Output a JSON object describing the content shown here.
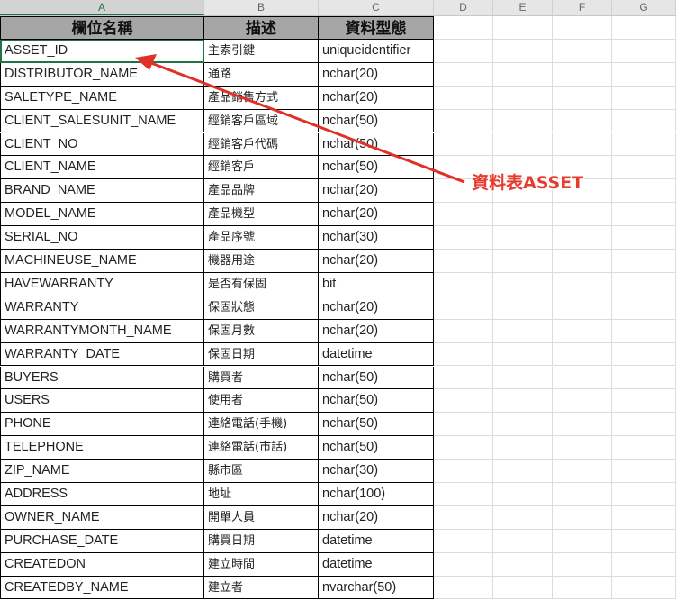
{
  "columns": [
    "A",
    "B",
    "C",
    "D",
    "E",
    "F",
    "G"
  ],
  "header": {
    "field": "欄位名稱",
    "desc": "描述",
    "type": "資料型態"
  },
  "rows": [
    {
      "field": "ASSET_ID",
      "desc": "主索引鍵",
      "type": "uniqueidentifier"
    },
    {
      "field": "DISTRIBUTOR_NAME",
      "desc": "通路",
      "type": "nchar(20)"
    },
    {
      "field": "SALETYPE_NAME",
      "desc": "產品銷售方式",
      "type": "nchar(20)"
    },
    {
      "field": "CLIENT_SALESUNIT_NAME",
      "desc": "經銷客戶區域",
      "type": "nchar(50)"
    },
    {
      "field": "CLIENT_NO",
      "desc": "經銷客戶代碼",
      "type": "nchar(50)"
    },
    {
      "field": "CLIENT_NAME",
      "desc": "經銷客戶",
      "type": "nchar(50)"
    },
    {
      "field": "BRAND_NAME",
      "desc": "產品品牌",
      "type": "nchar(20)"
    },
    {
      "field": "MODEL_NAME",
      "desc": "產品機型",
      "type": "nchar(20)"
    },
    {
      "field": "SERIAL_NO",
      "desc": "產品序號",
      "type": "nchar(30)"
    },
    {
      "field": "MACHINEUSE_NAME",
      "desc": "機器用途",
      "type": "nchar(20)"
    },
    {
      "field": "HAVEWARRANTY",
      "desc": "是否有保固",
      "type": "bit"
    },
    {
      "field": "WARRANTY",
      "desc": "保固狀態",
      "type": "nchar(20)"
    },
    {
      "field": "WARRANTYMONTH_NAME",
      "desc": "保固月數",
      "type": "nchar(20)"
    },
    {
      "field": "WARRANTY_DATE",
      "desc": "保固日期",
      "type": "datetime"
    },
    {
      "field": "BUYERS",
      "desc": "購買者",
      "type": "nchar(50)"
    },
    {
      "field": "USERS",
      "desc": "使用者",
      "type": "nchar(50)"
    },
    {
      "field": "PHONE",
      "desc": "連絡電話(手機)",
      "type": "nchar(50)"
    },
    {
      "field": "TELEPHONE",
      "desc": "連絡電話(市話)",
      "type": "nchar(50)"
    },
    {
      "field": "ZIP_NAME",
      "desc": "縣市區",
      "type": "nchar(30)"
    },
    {
      "field": "ADDRESS",
      "desc": "地址",
      "type": "nchar(100)"
    },
    {
      "field": "OWNER_NAME",
      "desc": "開單人員",
      "type": "nchar(20)"
    },
    {
      "field": "PURCHASE_DATE",
      "desc": "購買日期",
      "type": "datetime"
    },
    {
      "field": "CREATEDON",
      "desc": "建立時間",
      "type": "datetime"
    },
    {
      "field": "CREATEDBY_NAME",
      "desc": "建立者",
      "type": "nvarchar(50)"
    }
  ],
  "annotation": {
    "text": "資料表ASSET",
    "color": "#e63b2e"
  }
}
